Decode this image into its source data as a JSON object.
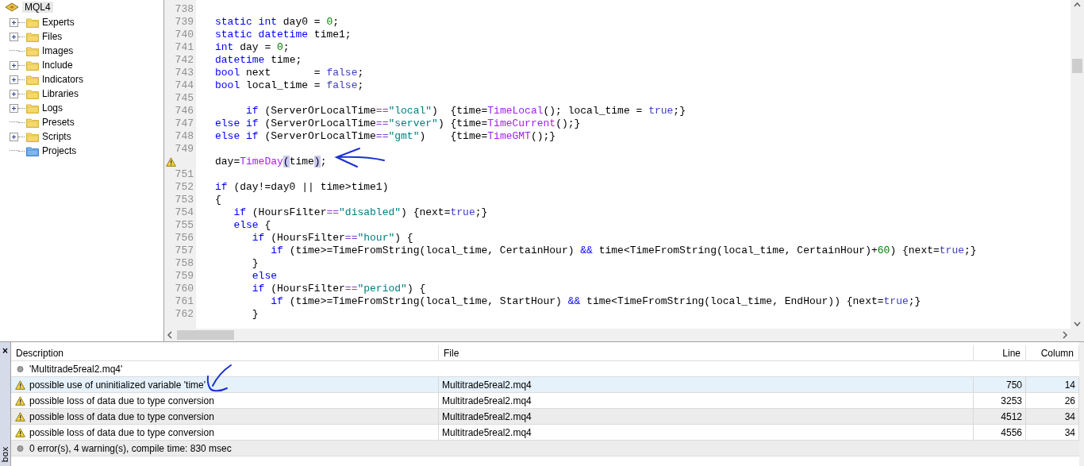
{
  "navigator": {
    "root": {
      "label": "MQL4",
      "selected": true
    },
    "items": [
      {
        "label": "Experts",
        "kind": "folder",
        "expandable": true
      },
      {
        "label": "Files",
        "kind": "folder",
        "expandable": true
      },
      {
        "label": "Images",
        "kind": "folder",
        "expandable": false
      },
      {
        "label": "Include",
        "kind": "folder",
        "expandable": true
      },
      {
        "label": "Indicators",
        "kind": "folder",
        "expandable": true
      },
      {
        "label": "Libraries",
        "kind": "folder",
        "expandable": true
      },
      {
        "label": "Logs",
        "kind": "folder",
        "expandable": true
      },
      {
        "label": "Presets",
        "kind": "folder",
        "expandable": false
      },
      {
        "label": "Scripts",
        "kind": "folder",
        "expandable": true
      },
      {
        "label": "Projects",
        "kind": "project",
        "expandable": false
      }
    ]
  },
  "editor": {
    "lines": [
      {
        "number": "738"
      },
      {
        "number": "739",
        "tokens": [
          {
            "kind": "kw",
            "text": "static int"
          },
          {
            "kind": "plain",
            "text": " day0 = "
          },
          {
            "kind": "num",
            "text": "0"
          },
          {
            "kind": "plain",
            "text": ";"
          }
        ]
      },
      {
        "number": "740",
        "tokens": [
          {
            "kind": "kw",
            "text": "static datetime"
          },
          {
            "kind": "plain",
            "text": " time1;"
          }
        ]
      },
      {
        "number": "741",
        "tokens": [
          {
            "kind": "kw",
            "text": "int"
          },
          {
            "kind": "plain",
            "text": " day = "
          },
          {
            "kind": "num",
            "text": "0"
          },
          {
            "kind": "plain",
            "text": ";"
          }
        ]
      },
      {
        "number": "742",
        "tokens": [
          {
            "kind": "kw",
            "text": "datetime"
          },
          {
            "kind": "plain",
            "text": " time;"
          }
        ]
      },
      {
        "number": "743",
        "tokens": [
          {
            "kind": "kw",
            "text": "bool"
          },
          {
            "kind": "plain",
            "text": " next       = "
          },
          {
            "kind": "const",
            "text": "false"
          },
          {
            "kind": "plain",
            "text": ";"
          }
        ]
      },
      {
        "number": "744",
        "tokens": [
          {
            "kind": "kw",
            "text": "bool"
          },
          {
            "kind": "plain",
            "text": " local_time = "
          },
          {
            "kind": "const",
            "text": "false"
          },
          {
            "kind": "plain",
            "text": ";"
          }
        ]
      },
      {
        "number": "745"
      },
      {
        "number": "746",
        "tokens": [
          {
            "kind": "kw",
            "text": "     if"
          },
          {
            "kind": "plain",
            "text": " (ServerOrLocalTime"
          },
          {
            "kind": "op",
            "text": "=="
          },
          {
            "kind": "str",
            "text": "\"local\""
          },
          {
            "kind": "plain",
            "text": ")  {time="
          },
          {
            "kind": "fn",
            "text": "TimeLocal"
          },
          {
            "kind": "plain",
            "text": "(); local_time = "
          },
          {
            "kind": "const",
            "text": "true"
          },
          {
            "kind": "plain",
            "text": ";}"
          }
        ]
      },
      {
        "number": "747",
        "tokens": [
          {
            "kind": "kw",
            "text": "else if"
          },
          {
            "kind": "plain",
            "text": " (ServerOrLocalTime"
          },
          {
            "kind": "op",
            "text": "=="
          },
          {
            "kind": "str",
            "text": "\"server\""
          },
          {
            "kind": "plain",
            "text": ") {time="
          },
          {
            "kind": "fn",
            "text": "TimeCurrent"
          },
          {
            "kind": "plain",
            "text": "();}"
          }
        ]
      },
      {
        "number": "748",
        "tokens": [
          {
            "kind": "kw",
            "text": "else if"
          },
          {
            "kind": "plain",
            "text": " (ServerOrLocalTime"
          },
          {
            "kind": "op",
            "text": "=="
          },
          {
            "kind": "str",
            "text": "\"gmt\""
          },
          {
            "kind": "plain",
            "text": ")    {time="
          },
          {
            "kind": "fn",
            "text": "TimeGMT"
          },
          {
            "kind": "plain",
            "text": "();}"
          }
        ]
      },
      {
        "number": "749"
      },
      {
        "kind": "warning",
        "tokens": [
          {
            "kind": "plain",
            "text": "day="
          },
          {
            "kind": "fn",
            "text": "TimeDay"
          },
          {
            "kind": "match",
            "text": "("
          },
          {
            "kind": "plain",
            "text": "time"
          },
          {
            "kind": "match",
            "text": ")"
          },
          {
            "kind": "plain",
            "text": ";"
          }
        ]
      },
      {
        "number": "751"
      },
      {
        "number": "752",
        "tokens": [
          {
            "kind": "kw",
            "text": "if"
          },
          {
            "kind": "plain",
            "text": " (day!=day0 || time>time1)"
          }
        ]
      },
      {
        "number": "753",
        "tokens": [
          {
            "kind": "plain",
            "text": "{"
          }
        ]
      },
      {
        "number": "754",
        "tokens": [
          {
            "kind": "kw",
            "text": "   if"
          },
          {
            "kind": "plain",
            "text": " (HoursFilter"
          },
          {
            "kind": "op",
            "text": "=="
          },
          {
            "kind": "str",
            "text": "\"disabled\""
          },
          {
            "kind": "plain",
            "text": ") {next="
          },
          {
            "kind": "const",
            "text": "true"
          },
          {
            "kind": "plain",
            "text": ";}"
          }
        ]
      },
      {
        "number": "755",
        "tokens": [
          {
            "kind": "kw",
            "text": "   else"
          },
          {
            "kind": "plain",
            "text": " {"
          }
        ]
      },
      {
        "number": "756",
        "tokens": [
          {
            "kind": "kw",
            "text": "      if"
          },
          {
            "kind": "plain",
            "text": " (HoursFilter"
          },
          {
            "kind": "op",
            "text": "=="
          },
          {
            "kind": "str",
            "text": "\"hour\""
          },
          {
            "kind": "plain",
            "text": ") {"
          }
        ]
      },
      {
        "number": "757",
        "tokens": [
          {
            "kind": "kw",
            "text": "         if"
          },
          {
            "kind": "plain",
            "text": " (time>=TimeFromString(local_time, CertainHour) "
          },
          {
            "kind": "kw",
            "text": "&&"
          },
          {
            "kind": "plain",
            "text": " time<TimeFromString(local_time, CertainHour)+"
          },
          {
            "kind": "num",
            "text": "60"
          },
          {
            "kind": "plain",
            "text": ") {next="
          },
          {
            "kind": "const",
            "text": "true"
          },
          {
            "kind": "plain",
            "text": ";}"
          }
        ]
      },
      {
        "number": "758",
        "tokens": [
          {
            "kind": "plain",
            "text": "      }"
          }
        ]
      },
      {
        "number": "759",
        "tokens": [
          {
            "kind": "kw",
            "text": "      else"
          }
        ]
      },
      {
        "number": "760",
        "tokens": [
          {
            "kind": "kw",
            "text": "      if"
          },
          {
            "kind": "plain",
            "text": " (HoursFilter"
          },
          {
            "kind": "op",
            "text": "=="
          },
          {
            "kind": "str",
            "text": "\"period\""
          },
          {
            "kind": "plain",
            "text": ") {"
          }
        ]
      },
      {
        "number": "761",
        "tokens": [
          {
            "kind": "kw",
            "text": "         if"
          },
          {
            "kind": "plain",
            "text": " (time>=TimeFromString(local_time, StartHour) "
          },
          {
            "kind": "kw",
            "text": "&&"
          },
          {
            "kind": "plain",
            "text": " time<TimeFromString(local_time, EndHour)) {next="
          },
          {
            "kind": "const",
            "text": "true"
          },
          {
            "kind": "plain",
            "text": ";}"
          }
        ]
      },
      {
        "number": "762",
        "tokens": [
          {
            "kind": "plain",
            "text": "      }"
          }
        ]
      }
    ]
  },
  "toolbox": {
    "close": "×",
    "title": "box",
    "columns": [
      "Description",
      "File",
      "Line",
      "Column"
    ],
    "rows": [
      {
        "kind": "info",
        "description": "'Multitrade5real2.mq4'",
        "selected": false
      },
      {
        "kind": "warning",
        "description": "possible use of uninitialized variable 'time'",
        "file": "Multitrade5real2.mq4",
        "line": "750",
        "column": "14",
        "selected": true
      },
      {
        "kind": "warning",
        "description": "possible loss of data due to type conversion",
        "file": "Multitrade5real2.mq4",
        "line": "3253",
        "column": "26",
        "selected": false
      },
      {
        "kind": "warning",
        "description": "possible loss of data due to type conversion",
        "file": "Multitrade5real2.mq4",
        "line": "4512",
        "column": "34",
        "selected": false
      },
      {
        "kind": "warning",
        "description": "possible loss of data due to type conversion",
        "file": "Multitrade5real2.mq4",
        "line": "4556",
        "column": "34",
        "selected": false
      },
      {
        "kind": "info",
        "description": "0 error(s), 4 warning(s), compile time: 830 msec",
        "selected": false
      }
    ]
  }
}
